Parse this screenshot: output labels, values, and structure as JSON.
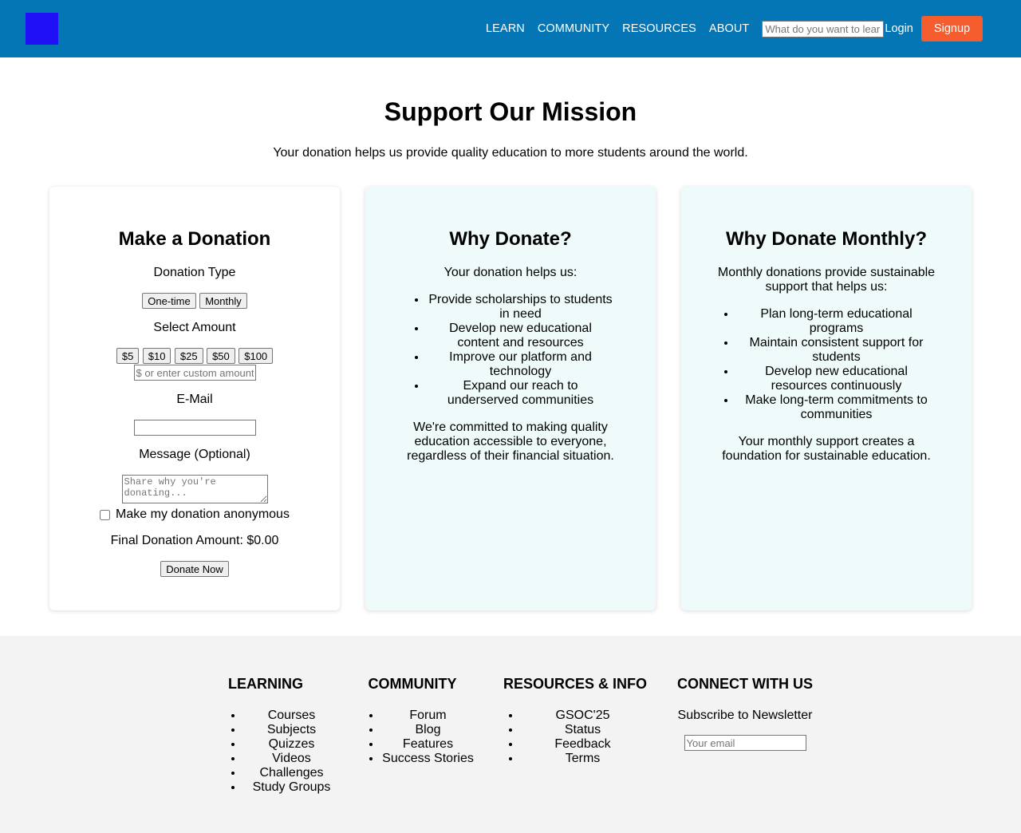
{
  "nav": {
    "items": [
      "LEARN",
      "COMMUNITY",
      "RESOURCES",
      "ABOUT"
    ],
    "search_placeholder": "What do you want to learn?",
    "login": "Login",
    "signup": "Signup"
  },
  "hero": {
    "title": "Support Our Mission",
    "subtitle": "Your donation helps us provide quality education to more students around the world."
  },
  "donation_form": {
    "title": "Make a Donation",
    "type_label": "Donation Type",
    "type_options": [
      "One-time",
      "Monthly"
    ],
    "amount_label": "Select Amount",
    "amount_options": [
      "$5",
      "$10",
      "$25",
      "$50",
      "$100"
    ],
    "custom_amount_placeholder": "$ or enter custom amount",
    "email_label": "E-Mail",
    "message_label": "Message (Optional)",
    "message_placeholder": "Share why you're donating...",
    "anonymous_label": "Make my donation anonymous",
    "final_amount": "Final Donation Amount: $0.00",
    "submit": "Donate Now"
  },
  "why_donate": {
    "title": "Why Donate?",
    "intro": "Your donation helps us:",
    "items": [
      "Provide scholarships to students in need",
      "Develop new educational content and resources",
      "Improve our platform and technology",
      "Expand our reach to underserved communities"
    ],
    "closing": "We're committed to making quality education accessible to everyone, regardless of their financial situation."
  },
  "why_monthly": {
    "title": "Why Donate Monthly?",
    "intro": "Monthly donations provide sustainable support that helps us:",
    "items": [
      "Plan long-term educational programs",
      "Maintain consistent support for students",
      "Develop new educational resources continuously",
      "Make long-term commitments to communities"
    ],
    "closing": "Your monthly support creates a foundation for sustainable education."
  },
  "footer": {
    "learning": {
      "title": "LEARNING",
      "items": [
        "Courses",
        "Subjects",
        "Quizzes",
        "Videos",
        "Challenges",
        "Study Groups"
      ]
    },
    "community": {
      "title": "COMMUNITY",
      "items": [
        "Forum",
        "Blog",
        "Features",
        "Success Stories"
      ]
    },
    "resources": {
      "title": "RESOURCES & INFO",
      "items": [
        "GSOC'25",
        "Status",
        "Feedback",
        "Terms"
      ]
    },
    "connect": {
      "title": "CONNECT WITH US",
      "newsletter": "Subscribe to Newsletter",
      "email_placeholder": "Your email"
    }
  },
  "colors": {
    "header": "#0476b5",
    "logo": "#2010f6",
    "signup": "#f55d2f",
    "card_tint": "#effbfa",
    "footer": "#f3f3f3"
  }
}
